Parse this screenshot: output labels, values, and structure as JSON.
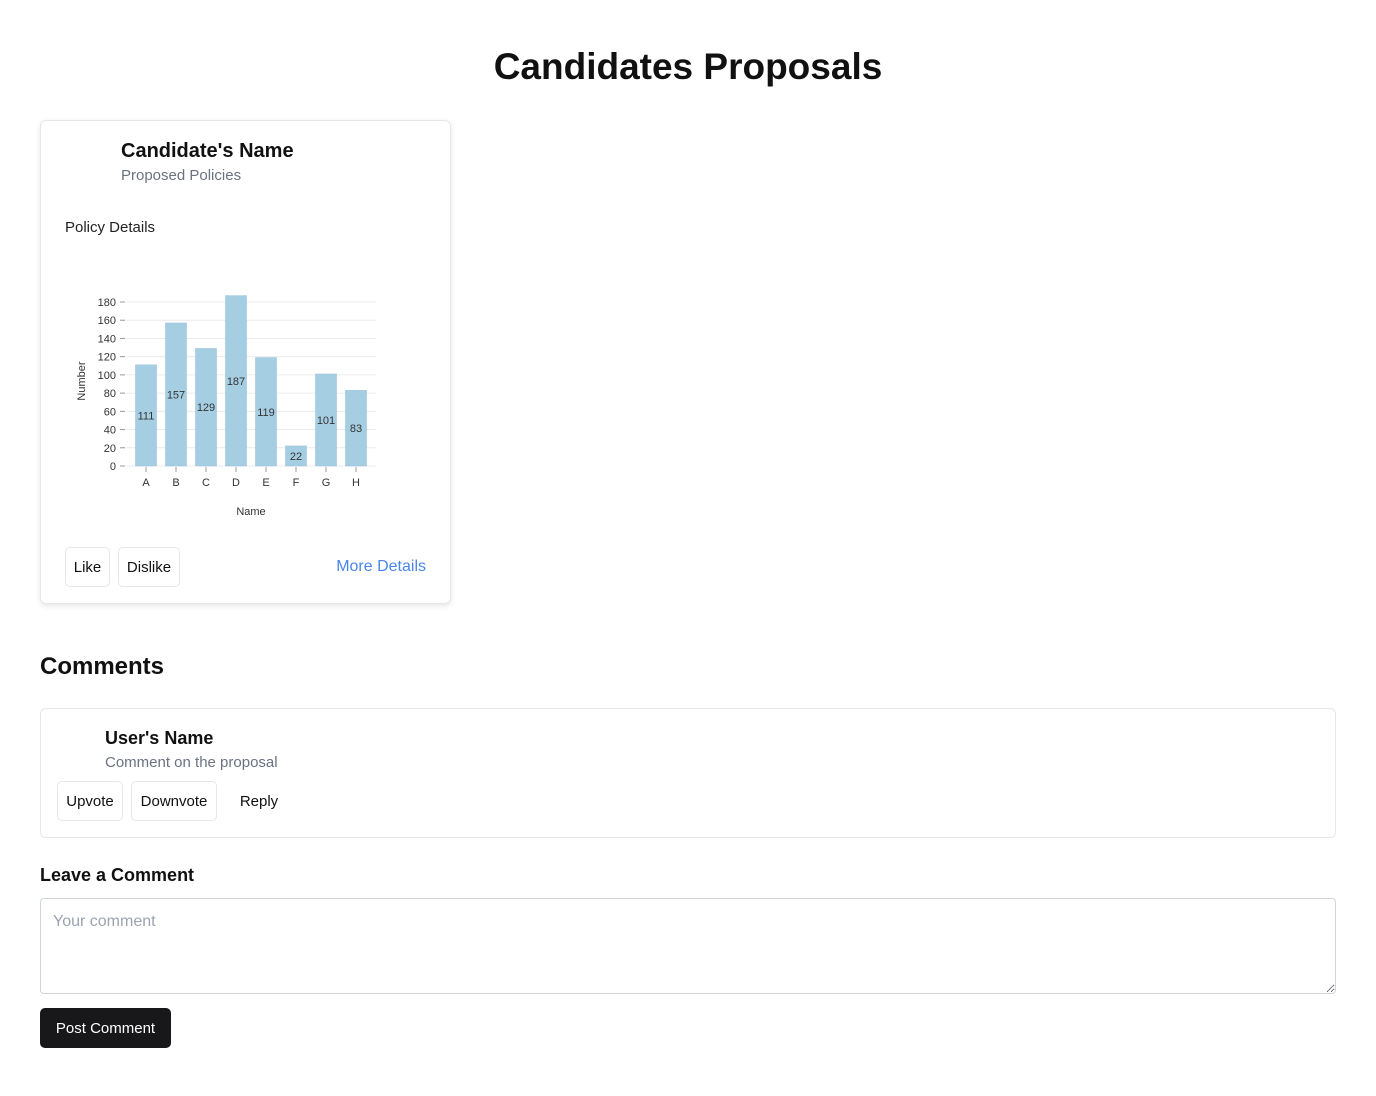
{
  "page_title": "Candidates Proposals",
  "card": {
    "name": "Candidate's Name",
    "subtitle": "Proposed Policies",
    "section": "Policy Details",
    "like": "Like",
    "dislike": "Dislike",
    "more": "More Details"
  },
  "chart_data": {
    "type": "bar",
    "categories": [
      "A",
      "B",
      "C",
      "D",
      "E",
      "F",
      "G",
      "H"
    ],
    "values": [
      111,
      157,
      129,
      187,
      119,
      22,
      101,
      83
    ],
    "xlabel": "Name",
    "ylabel": "Number",
    "ylim": [
      0,
      180
    ],
    "yticks": [
      0,
      20,
      40,
      60,
      80,
      100,
      120,
      140,
      160,
      180
    ],
    "grid": true,
    "bar_color": "#a6cee3",
    "data_labels": true
  },
  "comments": {
    "title": "Comments",
    "items": [
      {
        "user": "User's Name",
        "text": "Comment on the proposal",
        "upvote": "Upvote",
        "downvote": "Downvote",
        "reply": "Reply"
      }
    ]
  },
  "leave": {
    "title": "Leave a Comment",
    "placeholder": "Your comment",
    "post": "Post Comment"
  }
}
